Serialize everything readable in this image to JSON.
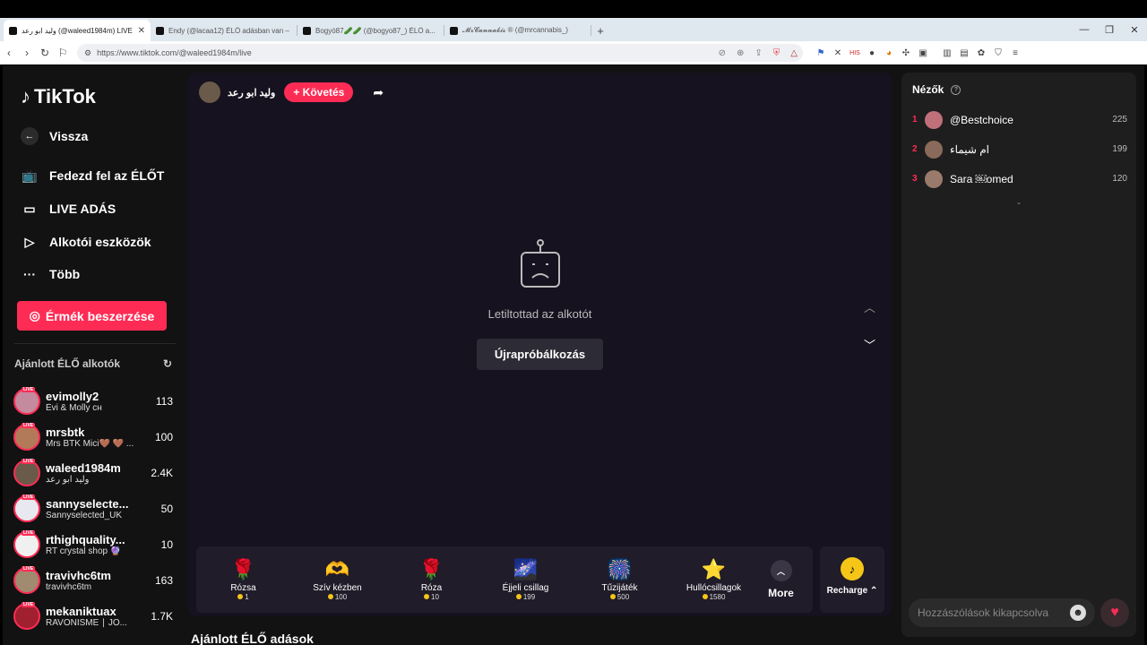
{
  "browser": {
    "tabs": [
      {
        "title": "وليد ابو رعد (@waleed1984m) LIVE",
        "active": true
      },
      {
        "title": "Endy (@lacaa12) ÉLŐ adásban van –",
        "active": false
      },
      {
        "title": "Bogyó87🥒🥒 (@bogyo87_) ÉLŐ a...",
        "active": false
      },
      {
        "title": "𝓜𝓻𝓒𝓪𝓷𝓷𝓪𝓫𝓲𝓼 ® (@mrcannabis_)",
        "active": false
      }
    ],
    "url": "https://www.tiktok.com/@waleed1984m/live"
  },
  "sidebar": {
    "logo": "TikTok",
    "back": "Vissza",
    "items": [
      {
        "label": "Fedezd fel az ÉLŐT",
        "icon": "tv-icon"
      },
      {
        "label": "LIVE ADÁS",
        "icon": "camera-icon"
      },
      {
        "label": "Alkotói eszközök",
        "icon": "play-icon"
      },
      {
        "label": "Több",
        "icon": "more-icon"
      }
    ],
    "coins_button": "Érmék beszerzése",
    "recommended_title": "Ajánlott ÉLŐ alkotók",
    "recommended": [
      {
        "name": "evimolly2",
        "sub": "Évi & Molly ᴄʜ",
        "count": "113",
        "color": "#c48a9e"
      },
      {
        "name": "mrsbtk",
        "sub": "Mrs BTK Mici🤎 🤎 ...",
        "count": "100",
        "color": "#b37a5a"
      },
      {
        "name": "waleed1984m",
        "sub": "وليد ابو رعد",
        "count": "2.4K",
        "color": "#6a5a4a"
      },
      {
        "name": "sannyselecte...",
        "sub": "Sannyselected_UK",
        "count": "50",
        "color": "#e8e8f0"
      },
      {
        "name": "rthighquality...",
        "sub": "RT crystal shop 🔮",
        "count": "10",
        "color": "#f0f0f0"
      },
      {
        "name": "travivhc6tm",
        "sub": "travivhc6tm",
        "count": "163",
        "color": "#a08a70"
      },
      {
        "name": "mekaniktuax",
        "sub": "RAVONISME ∣ JO...",
        "count": "1.7K",
        "color": "#a02030"
      }
    ]
  },
  "stage": {
    "host_name": "وليد ابو رعد",
    "follow": "+ Követés",
    "blocked_msg": "Letiltottad az alkotót",
    "retry": "Újrapróbálkozás",
    "gifts": [
      {
        "name": "Rózsa",
        "price": "1",
        "icon": "🌹"
      },
      {
        "name": "Szív kézben",
        "price": "100",
        "icon": "🫶"
      },
      {
        "name": "Róza",
        "price": "10",
        "icon": "🌹"
      },
      {
        "name": "Éjjeli csillag",
        "price": "199",
        "icon": "🌌"
      },
      {
        "name": "Tűzijáték",
        "price": "500",
        "icon": "🎆"
      },
      {
        "name": "Hullócsillagok",
        "price": "1580",
        "icon": "⭐"
      }
    ],
    "more": "More",
    "recharge": "Recharge ⌃"
  },
  "below_title": "Ajánlott ÉLŐ adások",
  "viewers": {
    "title": "Nézők",
    "list": [
      {
        "rank": "1",
        "name": "@Bestchoice",
        "count": "225",
        "color": "#c0707a"
      },
      {
        "rank": "2",
        "name": "ام شيماء",
        "count": "199",
        "color": "#8a6a5a"
      },
      {
        "rank": "3",
        "name": "Sara ￼omed",
        "count": "120",
        "color": "#9a7a6a"
      }
    ],
    "comment_placeholder": "Hozzászólások kikapcsolva"
  }
}
